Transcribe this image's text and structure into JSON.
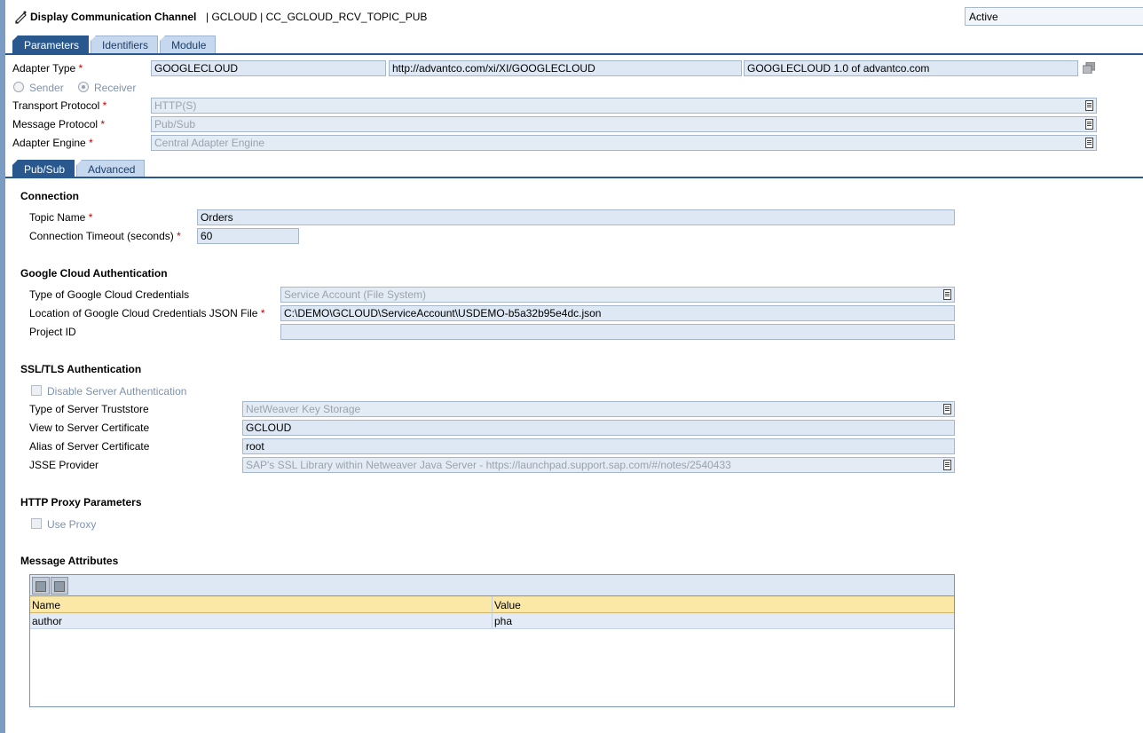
{
  "header": {
    "title": "Display Communication Channel",
    "path": "| GCLOUD | CC_GCLOUD_RCV_TOPIC_PUB",
    "status": "Active"
  },
  "main_tabs": [
    {
      "label": "Parameters",
      "active": true
    },
    {
      "label": "Identifiers",
      "active": false
    },
    {
      "label": "Module",
      "active": false
    }
  ],
  "adapter": {
    "type_label": "Adapter Type",
    "type_value": "GOOGLECLOUD",
    "namespace": "http://advantco.com/xi/XI/GOOGLECLOUD",
    "version": "GOOGLECLOUD 1.0 of advantco.com",
    "sender_label": "Sender",
    "receiver_label": "Receiver",
    "transport_label": "Transport Protocol",
    "transport_value": "HTTP(S)",
    "message_label": "Message Protocol",
    "message_value": "Pub/Sub",
    "engine_label": "Adapter Engine",
    "engine_value": "Central Adapter Engine",
    "required_mark": "*"
  },
  "sub_tabs": [
    {
      "label": "Pub/Sub",
      "active": true
    },
    {
      "label": "Advanced",
      "active": false
    }
  ],
  "connection": {
    "title": "Connection",
    "topic_label": "Topic Name",
    "topic_value": "Orders",
    "timeout_label": "Connection Timeout (seconds)",
    "timeout_value": "60"
  },
  "gcauth": {
    "title": "Google Cloud Authentication",
    "cred_type_label": "Type of Google Cloud Credentials",
    "cred_type_value": "Service Account (File System)",
    "cred_location_label": "Location of Google Cloud Credentials JSON File",
    "cred_location_value": "C:\\DEMO\\GCLOUD\\ServiceAccount\\USDEMO-b5a32b95e4dc.json",
    "project_label": "Project ID",
    "project_value": ""
  },
  "ssl": {
    "title": "SSL/TLS Authentication",
    "disable_label": "Disable Server Authentication",
    "truststore_label": "Type of Server Truststore",
    "truststore_value": "NetWeaver Key Storage",
    "view_label": "View to Server Certificate",
    "view_value": "GCLOUD",
    "alias_label": "Alias of Server Certificate",
    "alias_value": "root",
    "jsse_label": "JSSE Provider",
    "jsse_value": "SAP's SSL Library within Netweaver Java Server - https://launchpad.support.sap.com/#/notes/2540433"
  },
  "proxy": {
    "title": "HTTP Proxy Parameters",
    "use_label": "Use Proxy"
  },
  "attributes": {
    "title": "Message Attributes",
    "columns": [
      "Name",
      "Value"
    ],
    "rows": [
      {
        "name": "author",
        "value": "pha"
      }
    ]
  },
  "colors": {
    "tab_active": "#29588f",
    "field_bg": "#dde8f4",
    "table_header": "#fbe7a6",
    "required": "#c00000"
  }
}
